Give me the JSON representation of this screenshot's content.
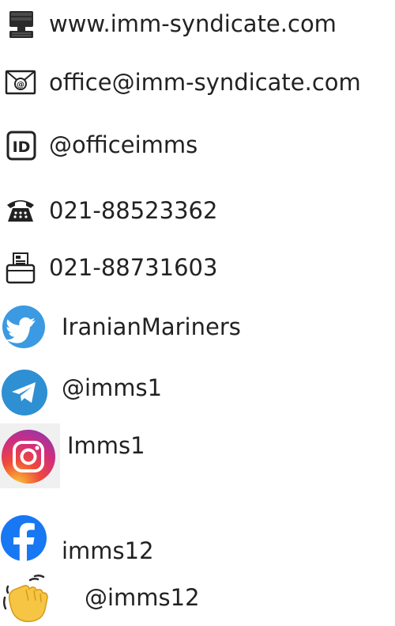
{
  "contacts": {
    "website": {
      "icon": "desktop-computer-icon",
      "text": "www.imm-syndicate.com"
    },
    "email": {
      "icon": "envelope-at-icon",
      "text": "office@imm-syndicate.com"
    },
    "id": {
      "icon": "id-icon",
      "text": "@officeimms"
    },
    "phone": {
      "icon": "telephone-icon",
      "text": "021-88523362"
    },
    "fax": {
      "icon": "fax-machine-icon",
      "text": "021-88731603"
    },
    "twitter": {
      "icon": "twitter-bird-icon",
      "text": "IranianMariners"
    },
    "telegram": {
      "icon": "telegram-plane-icon",
      "text": "@imms1"
    },
    "instagram": {
      "icon": "instagram-camera-icon",
      "text": "Imms1"
    },
    "facebook": {
      "icon": "facebook-f-icon",
      "text": "imms12"
    },
    "waving": {
      "icon": "waving-hand-icon",
      "text": "@imms12"
    }
  },
  "colors": {
    "text": "#222222",
    "twitter": "#3b9ae1",
    "telegram": "#2f8fd3",
    "facebook": "#1877f2",
    "instagram_gradient": [
      "#f9c234",
      "#ef4a3a",
      "#d12d7d",
      "#7e3bb8"
    ],
    "waving_hand": "#f6c544"
  }
}
